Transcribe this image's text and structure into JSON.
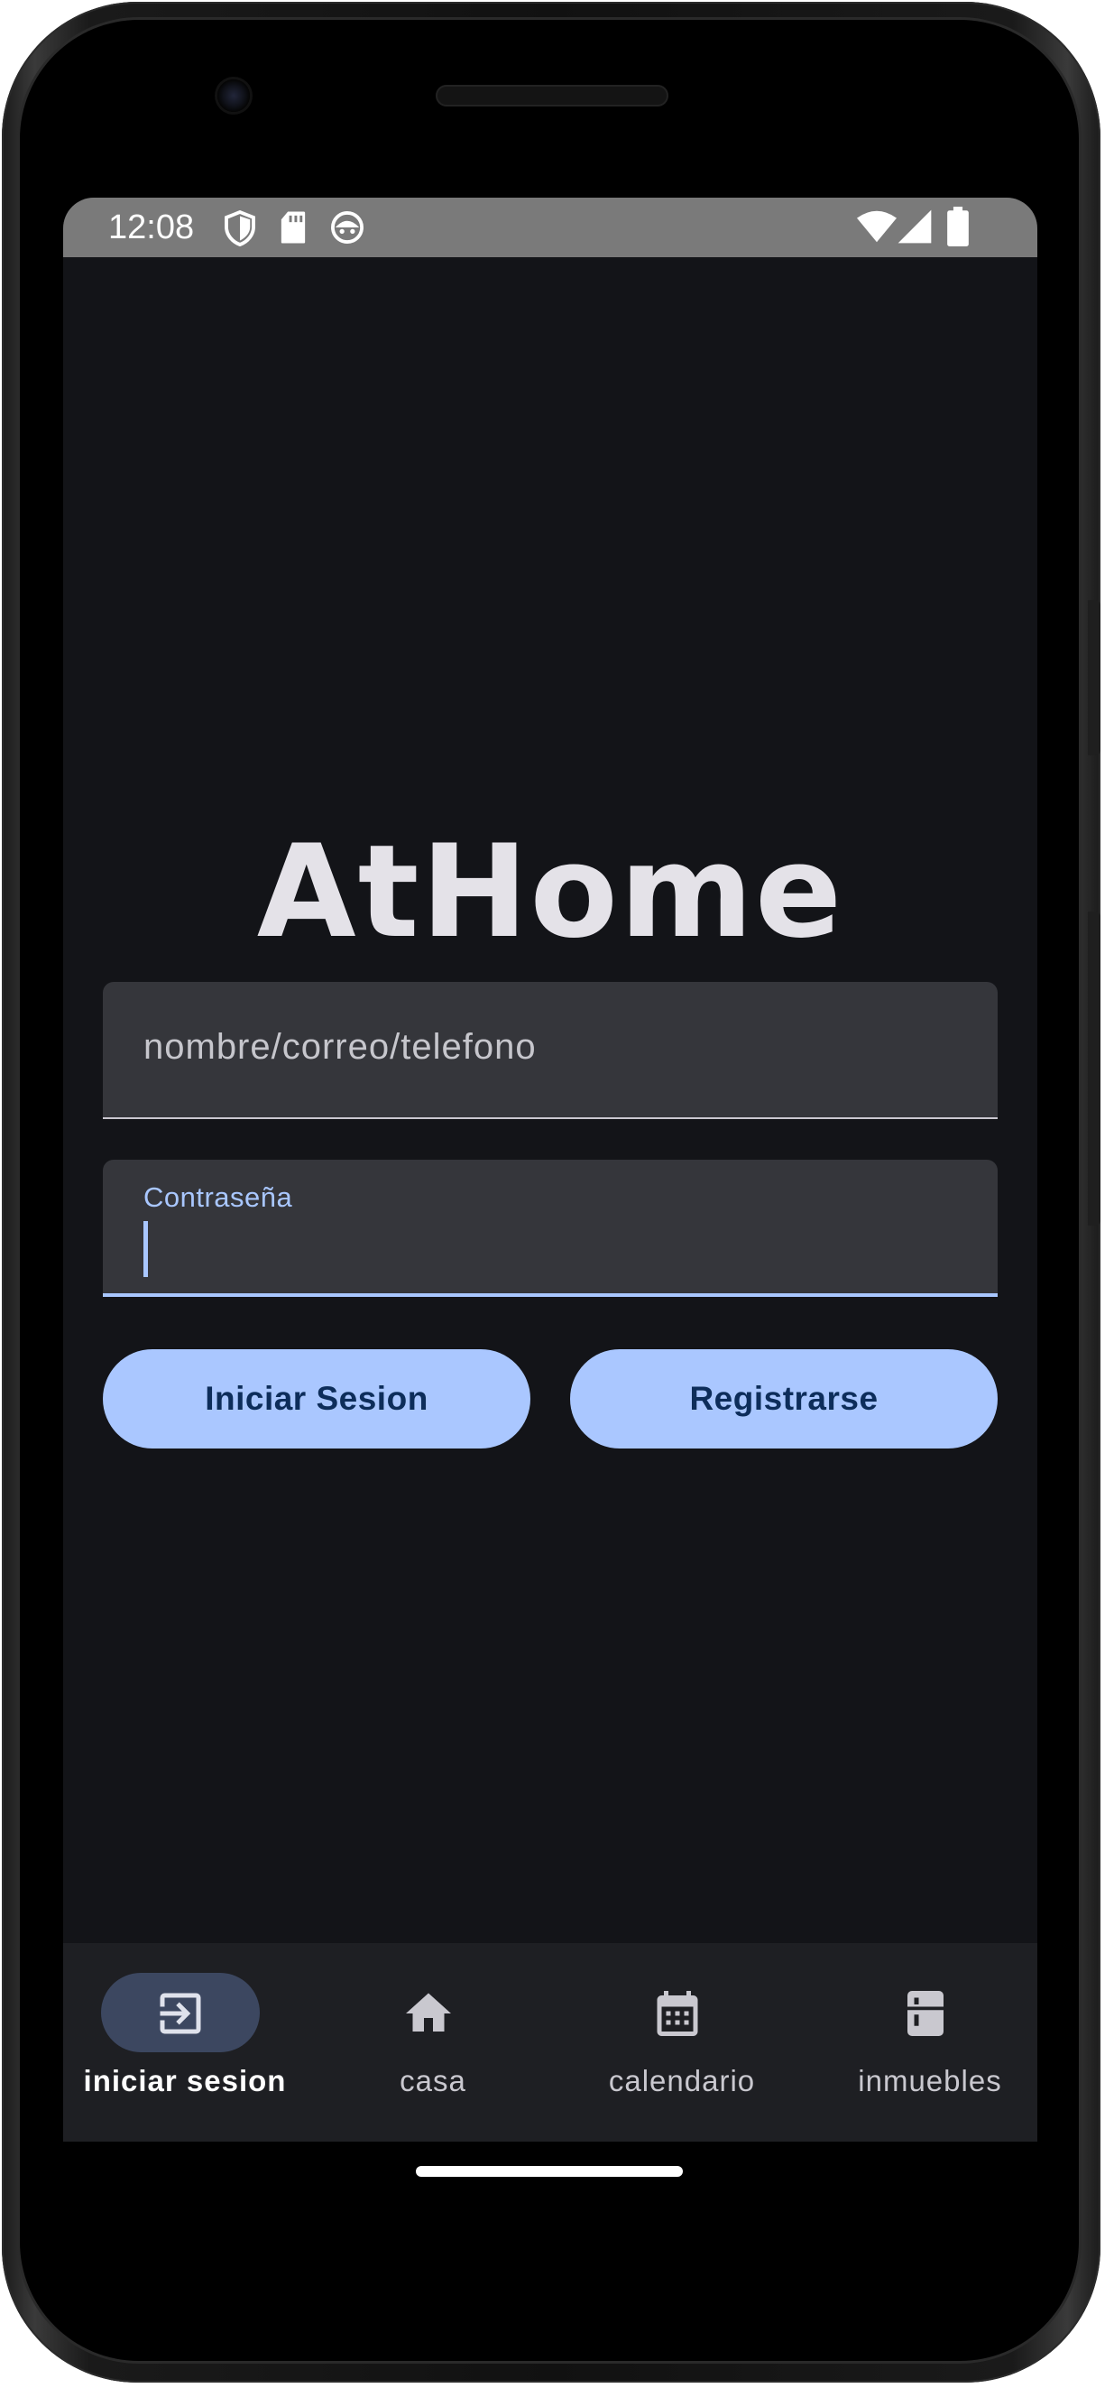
{
  "status_bar": {
    "time": "12:08",
    "left_icons": [
      "shield-icon",
      "sd-card-icon",
      "android-face-icon"
    ],
    "right_icons": [
      "wifi-icon",
      "cellular-signal-icon",
      "battery-icon"
    ]
  },
  "app": {
    "logo_text": "AtHome"
  },
  "login_form": {
    "user_field": {
      "placeholder": "nombre/correo/telefono",
      "value": ""
    },
    "password_field": {
      "label": "Contraseña",
      "value": ""
    },
    "login_button": "Iniciar Sesion",
    "register_button": "Registrarse"
  },
  "bottom_nav": {
    "items": [
      {
        "label": "iniciar sesion",
        "icon": "login-icon",
        "active": true
      },
      {
        "label": "casa",
        "icon": "home-icon",
        "active": false
      },
      {
        "label": "calendario",
        "icon": "calendar-icon",
        "active": false
      },
      {
        "label": "inmuebles",
        "icon": "fridge-icon",
        "active": false
      }
    ]
  },
  "colors": {
    "background": "#131418",
    "accent": "#aac7ff",
    "button_text": "#0d2d5a",
    "field_background": "#35363b",
    "nav_background": "#1e1f23",
    "nav_active_pill": "#3c4760",
    "status_bar": "#7a7a7a"
  }
}
